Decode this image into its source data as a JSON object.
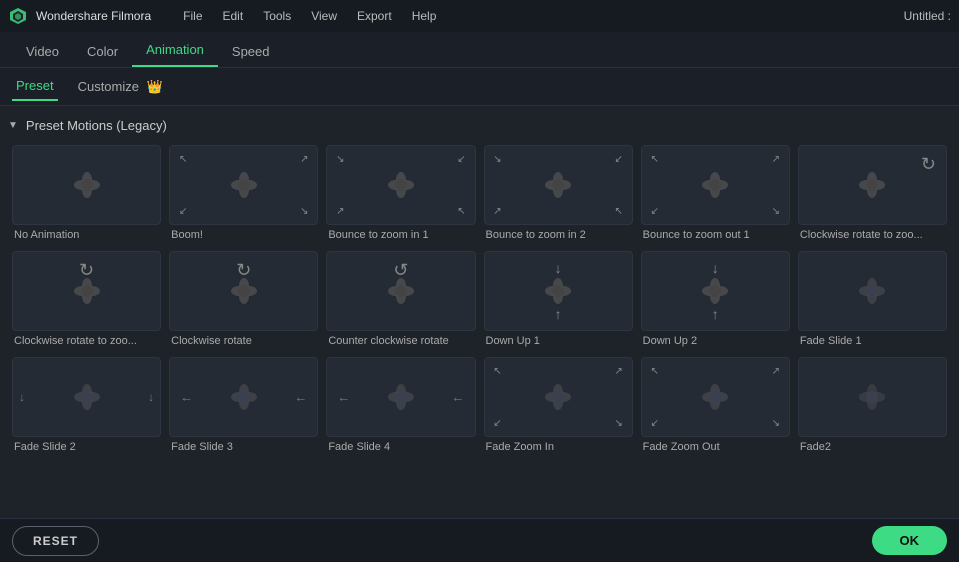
{
  "app": {
    "name": "Wondershare Filmora",
    "title": "Untitled :"
  },
  "menu": {
    "items": [
      "File",
      "Edit",
      "Tools",
      "View",
      "Export",
      "Help"
    ]
  },
  "tabs": {
    "items": [
      "Video",
      "Color",
      "Animation",
      "Speed"
    ],
    "active": "Animation"
  },
  "subtabs": {
    "items": [
      {
        "label": "Preset",
        "active": true,
        "crown": false
      },
      {
        "label": "Customize",
        "active": false,
        "crown": true
      }
    ]
  },
  "section": {
    "title": "Preset Motions (Legacy)",
    "collapsed": false
  },
  "animations": [
    {
      "label": "No Animation",
      "type": "none"
    },
    {
      "label": "Boom!",
      "type": "zoom-arrows"
    },
    {
      "label": "Bounce to zoom in 1",
      "type": "zoom-in-arrows"
    },
    {
      "label": "Bounce to zoom in 2",
      "type": "zoom-in-arrows2"
    },
    {
      "label": "Bounce to zoom out 1",
      "type": "zoom-out-arrows"
    },
    {
      "label": "Clockwise rotate to zoo...",
      "type": "rotate"
    },
    {
      "label": "Clockwise rotate to zoo...",
      "type": "rotate-zoom"
    },
    {
      "label": "Clockwise rotate",
      "type": "rotate-only"
    },
    {
      "label": "Counter clockwise rotate",
      "type": "counter-rotate"
    },
    {
      "label": "Down Up 1",
      "type": "v-arrows"
    },
    {
      "label": "Down Up 2",
      "type": "v-arrows2"
    },
    {
      "label": "Fade Slide 1",
      "type": "fade"
    },
    {
      "label": "Fade Slide 2",
      "type": "fade-h"
    },
    {
      "label": "Fade Slide 3",
      "type": "fade-h2"
    },
    {
      "label": "Fade Slide 4",
      "type": "fade-h3"
    },
    {
      "label": "Fade Zoom In",
      "type": "fade-zoom-in"
    },
    {
      "label": "Fade Zoom Out",
      "type": "fade-zoom-out"
    },
    {
      "label": "Fade2",
      "type": "fade2"
    }
  ],
  "buttons": {
    "reset": "RESET",
    "ok": "OK"
  }
}
